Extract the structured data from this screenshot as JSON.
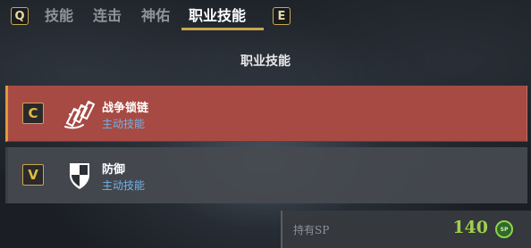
{
  "tabs": {
    "prev_key": "Q",
    "next_key": "E",
    "items": [
      {
        "label": "技能"
      },
      {
        "label": "连击"
      },
      {
        "label": "神佑"
      },
      {
        "label": "职业技能"
      }
    ],
    "active_index": 3
  },
  "section_title": "职业技能",
  "skills": [
    {
      "key": "C",
      "name": "战争锁链",
      "type": "主动技能",
      "icon": "war-chains-icon",
      "selected": true
    },
    {
      "key": "V",
      "name": "防御",
      "type": "主动技能",
      "icon": "shield-icon",
      "selected": false
    }
  ],
  "sp": {
    "label": "持有SP",
    "value": "140",
    "icon_text": "SP",
    "icon": "sp-coin-icon"
  },
  "colors": {
    "accent_gold": "#c9a74e",
    "selected_row": "#a74a43",
    "skill_type": "#6fb4e8",
    "sp_value": "#9fd04a"
  }
}
